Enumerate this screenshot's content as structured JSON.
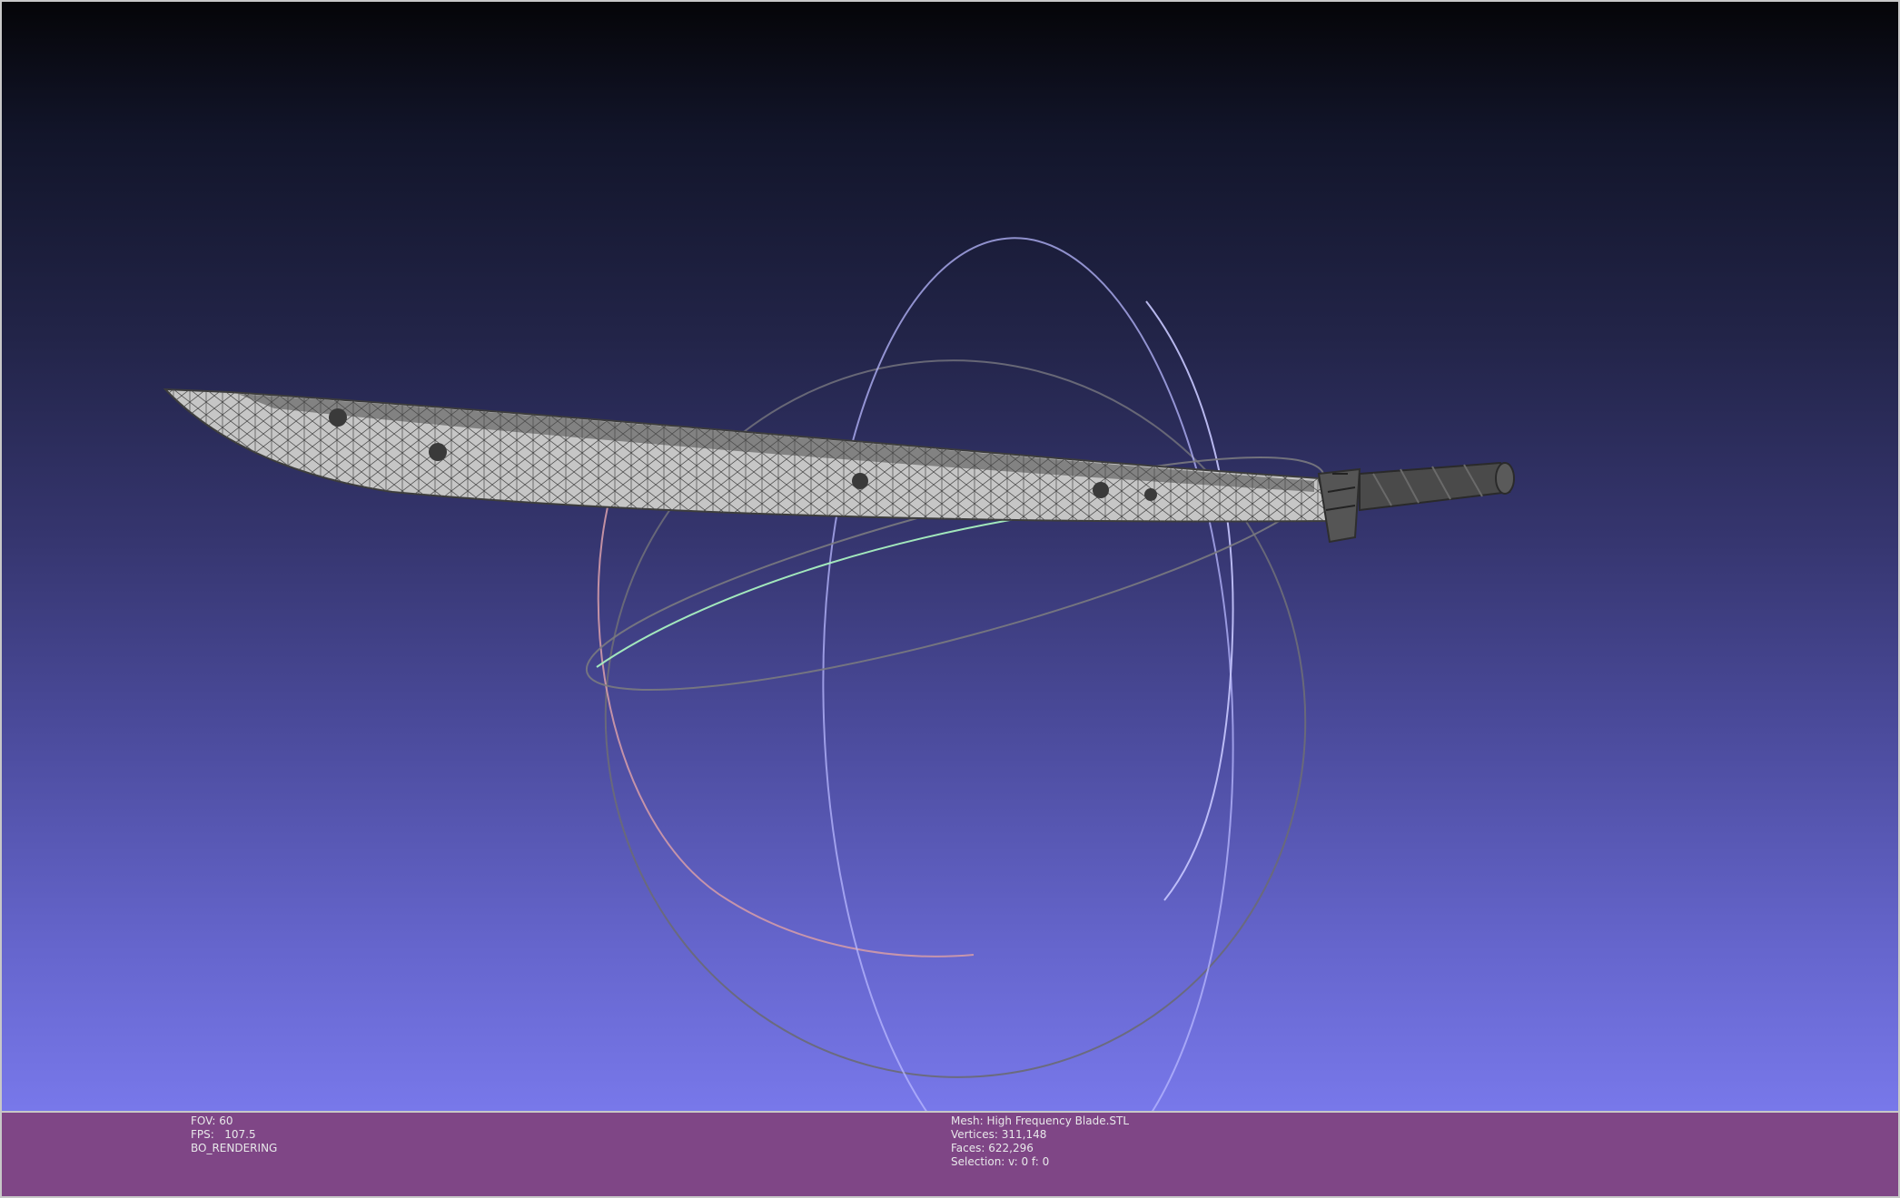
{
  "viewer_info": {
    "fov": "FOV: 60",
    "fps": "FPS:   107.5",
    "rendering_mode": "BO_RENDERING"
  },
  "mesh_info": {
    "mesh": "Mesh: High Frequency Blade.STL",
    "vertices": "Vertices: 311,148",
    "faces": "Faces: 622,296",
    "selection": "Selection: v: 0 f: 0"
  },
  "colors": {
    "status_bar": "#7f4686",
    "mesh_fill": "#c6c6c6",
    "wireframe": "#4a4a4a",
    "trackball_x": "#e09a9a",
    "trackball_y": "#b8b8ff",
    "trackball_z": "#a0f0b0"
  },
  "icons": [
    "trackball-gizmo",
    "blade-mesh"
  ]
}
